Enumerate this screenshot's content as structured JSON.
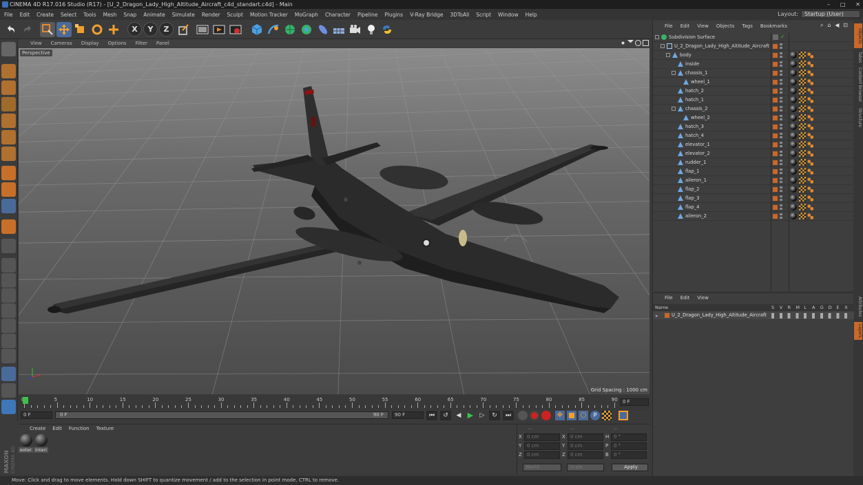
{
  "window": {
    "title": "CINEMA 4D R17.016 Studio (R17) - [U_2_Dragon_Lady_High_Altitude_Aircraft_c4d_standart.c4d] - Main",
    "controls": [
      "–",
      "□",
      "✕"
    ]
  },
  "menu": [
    "File",
    "Edit",
    "Create",
    "Select",
    "Tools",
    "Mesh",
    "Snap",
    "Animate",
    "Simulate",
    "Render",
    "Sculpt",
    "Motion Tracker",
    "MoGraph",
    "Character",
    "Pipeline",
    "Plugins",
    "V-Ray Bridge",
    "3DToAll",
    "Script",
    "Window",
    "Help"
  ],
  "layout": {
    "label": "Layout:",
    "value": "Startup (User)"
  },
  "toolbar": {
    "x": "X",
    "y": "Y",
    "z": "Z"
  },
  "viewport": {
    "menu": [
      "View",
      "Cameras",
      "Display",
      "Options",
      "Filter",
      "Panel"
    ],
    "camera_label": "Perspective",
    "grid_spacing": "Grid Spacing : 1000 cm"
  },
  "timeline": {
    "ticks": [
      "0",
      "5",
      "10",
      "15",
      "20",
      "25",
      "30",
      "35",
      "40",
      "45",
      "50",
      "55",
      "60",
      "65",
      "70",
      "75",
      "80",
      "85",
      "90"
    ],
    "current_frame": "0 F",
    "start": "0 F",
    "range_start": "0 F",
    "range_end": "90 F",
    "end": "90 F"
  },
  "materials": {
    "menu": [
      "Create",
      "Edit",
      "Function",
      "Texture"
    ],
    "items": [
      "exter",
      "interi"
    ]
  },
  "coordinates": {
    "header": [
      "--",
      "--",
      "--"
    ],
    "rows": [
      {
        "a": "X",
        "av": "0 cm",
        "b": "X",
        "bv": "0 cm",
        "c": "H",
        "cv": "0 °"
      },
      {
        "a": "Y",
        "av": "0 cm",
        "b": "Y",
        "bv": "0 cm",
        "c": "P",
        "cv": "0 °"
      },
      {
        "a": "Z",
        "av": "0 cm",
        "b": "Z",
        "bv": "0 cm",
        "c": "B",
        "cv": "0 °"
      }
    ],
    "mode": "World",
    "scale": "Scale",
    "apply": "Apply"
  },
  "objects": {
    "menu": [
      "File",
      "Edit",
      "View",
      "Objects",
      "Tags",
      "Bookmarks"
    ],
    "tree": [
      {
        "name": "Subdivision Surface",
        "depth": 0,
        "kind": "subdiv"
      },
      {
        "name": "U_2_Dragon_Lady_High_Altitude_Aircraft",
        "depth": 1,
        "kind": "null"
      },
      {
        "name": "body",
        "depth": 2,
        "kind": "poly"
      },
      {
        "name": "inside",
        "depth": 3,
        "kind": "poly"
      },
      {
        "name": "chassis_1",
        "depth": 3,
        "kind": "poly"
      },
      {
        "name": "wheel_1",
        "depth": 4,
        "kind": "poly"
      },
      {
        "name": "hatch_2",
        "depth": 3,
        "kind": "poly"
      },
      {
        "name": "hatch_1",
        "depth": 3,
        "kind": "poly"
      },
      {
        "name": "chassis_2",
        "depth": 3,
        "kind": "poly"
      },
      {
        "name": "wheel_2",
        "depth": 4,
        "kind": "poly"
      },
      {
        "name": "hatch_3",
        "depth": 3,
        "kind": "poly"
      },
      {
        "name": "hatch_4",
        "depth": 3,
        "kind": "poly"
      },
      {
        "name": "elevator_1",
        "depth": 3,
        "kind": "poly"
      },
      {
        "name": "elevator_2",
        "depth": 3,
        "kind": "poly"
      },
      {
        "name": "rudder_1",
        "depth": 3,
        "kind": "poly"
      },
      {
        "name": "flap_1",
        "depth": 3,
        "kind": "poly"
      },
      {
        "name": "aileron_1",
        "depth": 3,
        "kind": "poly"
      },
      {
        "name": "flap_2",
        "depth": 3,
        "kind": "poly"
      },
      {
        "name": "flap_3",
        "depth": 3,
        "kind": "poly"
      },
      {
        "name": "flap_4",
        "depth": 3,
        "kind": "poly"
      },
      {
        "name": "aileron_2",
        "depth": 3,
        "kind": "poly"
      }
    ]
  },
  "attributes": {
    "menu": [
      "File",
      "Edit",
      "View"
    ],
    "header": {
      "name": "Name",
      "cols": [
        "S",
        "V",
        "R",
        "M",
        "L",
        "A",
        "G",
        "D",
        "E",
        "X"
      ]
    },
    "row": "U_2_Dragon_Lady_High_Altitude_Aircraft"
  },
  "right_tabs": [
    "Objects",
    "Takes",
    "Content Browser",
    "Structure",
    "Attributes",
    "Layers"
  ],
  "status": "Move: Click and drag to move elements. Hold down SHIFT to quantize movement / add to the selection in point mode, CTRL to remove.",
  "colors": {
    "accent": "#c8682a",
    "selection": "#4a6a9a",
    "viewport_floor": "#5e5e5e"
  }
}
